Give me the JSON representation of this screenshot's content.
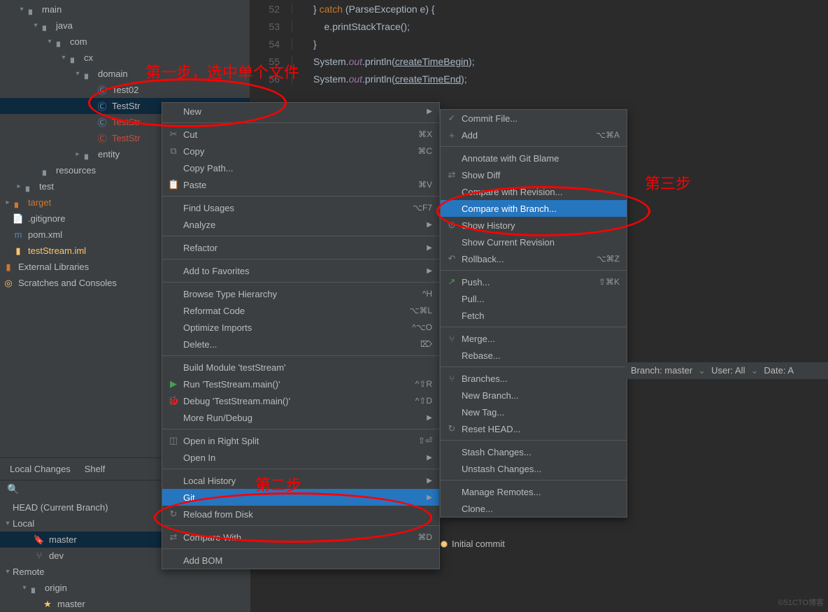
{
  "tree": {
    "main": "main",
    "java": "java",
    "com": "com",
    "cx": "cx",
    "domain": "domain",
    "test02": "Test02",
    "teststr1": "TestStr",
    "teststr2": "TestStr",
    "teststr3": "TestStr",
    "entity": "entity",
    "resources": "resources",
    "test": "test",
    "target": "target",
    "gitignore": ".gitignore",
    "pom": "pom.xml",
    "iml": "testStream.iml",
    "external": "External Libraries",
    "scratches": "Scratches and Consoles"
  },
  "code": {
    "l52": {
      "n": "52",
      "t1": "} ",
      "kw": "catch",
      "t2": " (ParseException e) {"
    },
    "l53": {
      "n": "53",
      "t": "    e.printStackTrace();"
    },
    "l54": {
      "n": "54",
      "t": "}"
    },
    "l55": {
      "n": "55",
      "sys": "System.",
      "out": "out",
      "p": ".println(",
      "arg": "createTimeBegin",
      "end": ");"
    },
    "l56": {
      "n": "56",
      "sys": "System.",
      "out": "out",
      "p": ".println(",
      "arg": "createTimeEnd",
      "end": ");"
    }
  },
  "tabs": {
    "local": "Local Changes",
    "shelf": "Shelf"
  },
  "vcs": {
    "head": "HEAD (Current Branch)",
    "local": "Local",
    "master": "master",
    "dev": "dev",
    "remote": "Remote",
    "origin": "origin",
    "origin_master": "master"
  },
  "menu1": [
    {
      "label": "New",
      "arrow": true
    },
    {
      "sep": true
    },
    {
      "label": "Cut",
      "icon": "✂",
      "shortcut": "⌘X"
    },
    {
      "label": "Copy",
      "icon": "⧉",
      "shortcut": "⌘C"
    },
    {
      "label": "Copy Path...",
      "icon": ""
    },
    {
      "label": "Paste",
      "icon": "📋",
      "shortcut": "⌘V"
    },
    {
      "sep": true
    },
    {
      "label": "Find Usages",
      "shortcut": "⌥F7"
    },
    {
      "label": "Analyze",
      "arrow": true
    },
    {
      "sep": true
    },
    {
      "label": "Refactor",
      "arrow": true
    },
    {
      "sep": true
    },
    {
      "label": "Add to Favorites",
      "arrow": true
    },
    {
      "sep": true
    },
    {
      "label": "Browse Type Hierarchy",
      "shortcut": "^H"
    },
    {
      "label": "Reformat Code",
      "shortcut": "⌥⌘L"
    },
    {
      "label": "Optimize Imports",
      "shortcut": "^⌥O"
    },
    {
      "label": "Delete...",
      "shortcut": "⌦"
    },
    {
      "sep": true
    },
    {
      "label": "Build Module 'testStream'"
    },
    {
      "label": "Run 'TestStream.main()'",
      "icon": "▶",
      "iconColor": "#499c54",
      "shortcut": "^⇧R"
    },
    {
      "label": "Debug 'TestStream.main()'",
      "icon": "🐞",
      "iconColor": "#499c54",
      "shortcut": "^⇧D"
    },
    {
      "label": "More Run/Debug",
      "arrow": true
    },
    {
      "sep": true
    },
    {
      "label": "Open in Right Split",
      "icon": "◫",
      "shortcut": "⇧⏎"
    },
    {
      "label": "Open In",
      "arrow": true
    },
    {
      "sep": true
    },
    {
      "label": "Local History",
      "arrow": true
    },
    {
      "label": "Git",
      "arrow": true,
      "selected": true
    },
    {
      "label": "Reload from Disk",
      "icon": "↻"
    },
    {
      "sep": true
    },
    {
      "label": "Compare With...",
      "icon": "⇄",
      "shortcut": "⌘D"
    },
    {
      "sep": true
    },
    {
      "label": "Add BOM"
    }
  ],
  "menu2": [
    {
      "label": "Commit File...",
      "icon": "✓"
    },
    {
      "label": "Add",
      "icon": "+",
      "shortcut": "⌥⌘A"
    },
    {
      "sep": true
    },
    {
      "label": "Annotate with Git Blame"
    },
    {
      "label": "Show Diff",
      "icon": "⇄"
    },
    {
      "label": "Compare with Revision..."
    },
    {
      "label": "Compare with Branch...",
      "selected": true
    },
    {
      "label": "Show History",
      "icon": "⊙"
    },
    {
      "label": "Show Current Revision"
    },
    {
      "label": "Rollback...",
      "icon": "↶",
      "shortcut": "⌥⌘Z"
    },
    {
      "sep": true
    },
    {
      "label": "Push...",
      "icon": "↗",
      "iconColor": "#499c54",
      "shortcut": "⇧⌘K"
    },
    {
      "label": "Pull..."
    },
    {
      "label": "Fetch"
    },
    {
      "sep": true
    },
    {
      "label": "Merge...",
      "icon": "⑂"
    },
    {
      "label": "Rebase..."
    },
    {
      "sep": true
    },
    {
      "label": "Branches...",
      "icon": "⑂"
    },
    {
      "label": "New Branch..."
    },
    {
      "label": "New Tag..."
    },
    {
      "label": "Reset HEAD...",
      "icon": "↻"
    },
    {
      "sep": true
    },
    {
      "label": "Stash Changes..."
    },
    {
      "label": "Unstash Changes..."
    },
    {
      "sep": true
    },
    {
      "label": "Manage Remotes..."
    },
    {
      "label": "Clone..."
    }
  ],
  "annotations": {
    "step1": "第一步，选中单个文件",
    "step2": "第二步",
    "step3": "第三步"
  },
  "git_bottom": "Initial commit",
  "info": {
    "branch": "Branch: master",
    "user": "User: All",
    "date": "Date: A"
  },
  "watermark": "©51CTO博客"
}
